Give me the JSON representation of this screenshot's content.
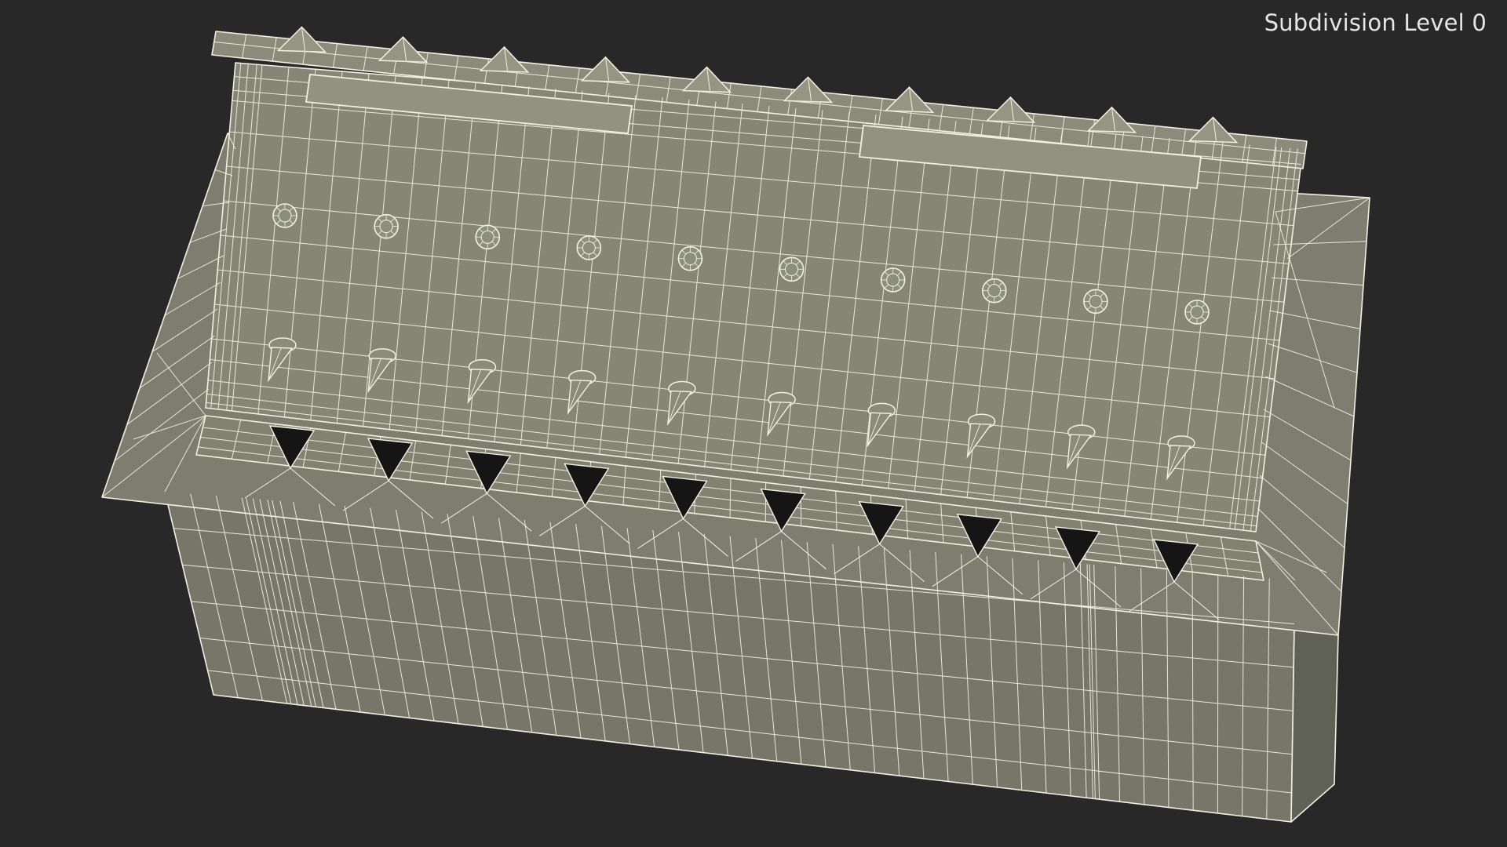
{
  "viewport": {
    "overlay_label": "Subdivision Level 0",
    "background_color": "#282828",
    "surface_color": "#7b7c6d",
    "wire_color": "#f1f1e3"
  },
  "model": {
    "spike_count": 10,
    "stud_count": 10
  }
}
